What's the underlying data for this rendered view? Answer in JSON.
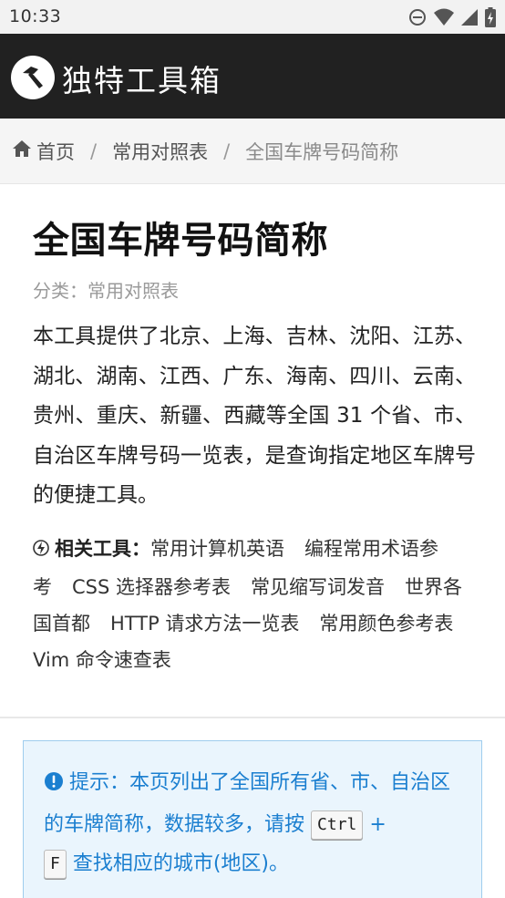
{
  "status_bar": {
    "time": "10:33",
    "icons": [
      "do-not-disturb-icon",
      "wifi-icon",
      "signal-icon",
      "battery-icon"
    ]
  },
  "app": {
    "title": "独特工具箱",
    "logo_icon": "hammer-icon",
    "header_color": "#212121"
  },
  "breadcrumb": {
    "home": "首页",
    "home_icon": "home-icon",
    "separator": "/",
    "category": "常用对照表",
    "current": "全国车牌号码简称"
  },
  "page": {
    "title": "全国车牌号码简称",
    "category_label": "分类：常用对照表",
    "description": "本工具提供了北京、上海、吉林、沈阳、江苏、湖北、湖南、江西、广东、海南、四川、云南、贵州、重庆、新疆、西藏等全国 31 个省、市、自治区车牌号码一览表，是查询指定地区车牌号的便捷工具。"
  },
  "related": {
    "icon": "lightning-icon",
    "label": "相关工具：",
    "items": [
      "常用计算机英语",
      "编程常用术语参考",
      "CSS 选择器参考表",
      "常见缩写词发音",
      "世界各国首都",
      "HTTP 请求方法一览表",
      "常用颜色参考表",
      "Vim 命令速查表"
    ]
  },
  "tip": {
    "icon": "exclamation-circle-icon",
    "text_before": "提示：本页列出了全国所有省、市、自治区的车牌简称，数据较多，请按",
    "key1": "Ctrl",
    "plus": "+",
    "key2": "F",
    "text_after": "查找相应的城市(地区)。",
    "accent_color": "#1b7fd0",
    "background_color": "#eaf5fd"
  }
}
